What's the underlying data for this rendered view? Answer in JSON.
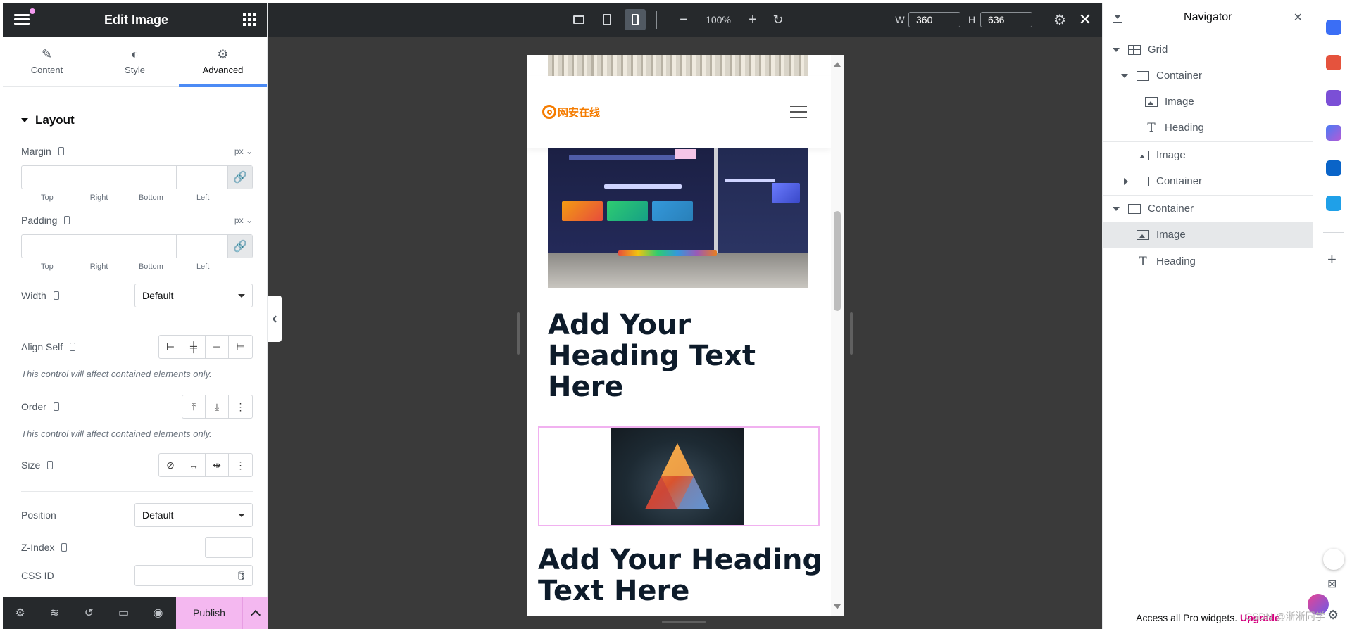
{
  "left_panel": {
    "title": "Edit Image",
    "tabs": [
      {
        "label": "Content",
        "icon": "pencil-icon"
      },
      {
        "label": "Style",
        "icon": "contrast-icon"
      },
      {
        "label": "Advanced",
        "icon": "gear-icon",
        "active": true
      }
    ],
    "section_title": "Layout",
    "margin": {
      "label": "Margin",
      "unit": "px",
      "sides": [
        "Top",
        "Right",
        "Bottom",
        "Left"
      ]
    },
    "padding": {
      "label": "Padding",
      "unit": "px",
      "sides": [
        "Top",
        "Right",
        "Bottom",
        "Left"
      ]
    },
    "width": {
      "label": "Width",
      "value": "Default"
    },
    "align_self": {
      "label": "Align Self",
      "note": "This control will affect contained elements only."
    },
    "order": {
      "label": "Order",
      "note": "This control will affect contained elements only."
    },
    "size": {
      "label": "Size"
    },
    "position": {
      "label": "Position",
      "value": "Default"
    },
    "z_index": {
      "label": "Z-Index"
    },
    "css_id": {
      "label": "CSS ID"
    },
    "publish_label": "Publish"
  },
  "topbar": {
    "zoom": "100%",
    "w_label": "W",
    "w_value": "360",
    "h_label": "H",
    "h_value": "636"
  },
  "preview": {
    "logo_text": "网安在线",
    "heading1": "Add Your Heading Text Here",
    "heading2": "Add Your Heading Text Here"
  },
  "navigator": {
    "title": "Navigator",
    "items": [
      {
        "label": "Grid",
        "icon": "grid-icon",
        "expander": "open"
      },
      {
        "label": "Container",
        "icon": "container-icon",
        "expander": "open"
      },
      {
        "label": "Image",
        "icon": "image-icon"
      },
      {
        "label": "Heading",
        "icon": "heading-icon"
      },
      {
        "label": "Image",
        "icon": "image-icon"
      },
      {
        "label": "Container",
        "icon": "container-icon",
        "expander": "closed"
      },
      {
        "label": "Container",
        "icon": "container-icon",
        "expander": "open"
      },
      {
        "label": "Image",
        "icon": "image-icon",
        "selected": true
      },
      {
        "label": "Heading",
        "icon": "heading-icon"
      }
    ],
    "footer_text": "Access all Pro widgets.",
    "footer_link": "Upgrade"
  },
  "watermark": "CSDN @淅淅同学",
  "colors": {
    "panel_dark": "#26292c",
    "accent_blue": "#4c8bf5",
    "publish_pink": "#f4b8f0",
    "selection_pink": "#f1b1f0",
    "upgrade_pink": "#d3007e",
    "canvas_bg": "#3a3a3a"
  }
}
